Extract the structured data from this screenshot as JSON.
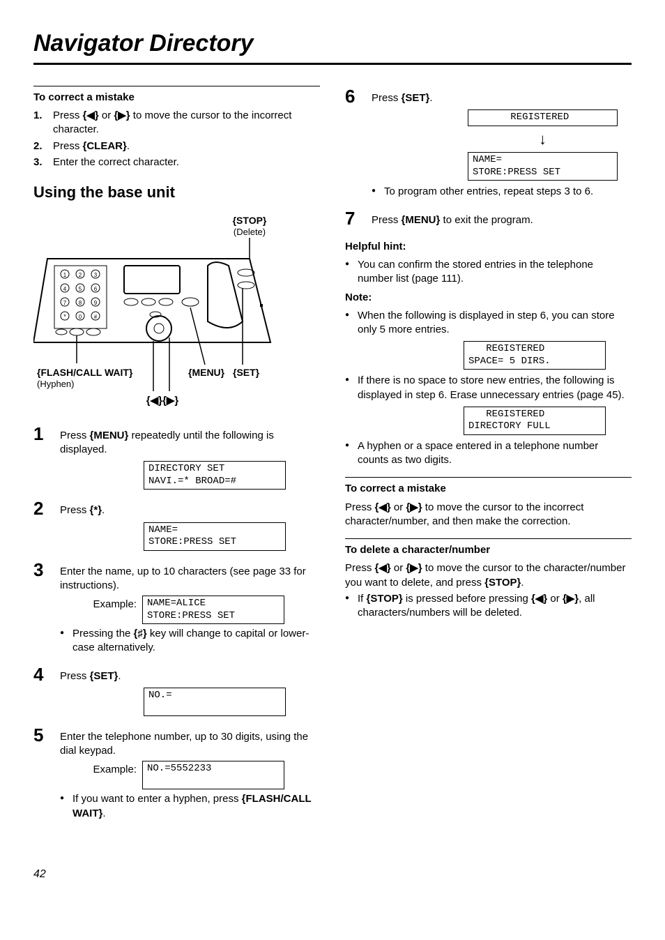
{
  "pageTitle": "Navigator Directory",
  "pageNumber": "42",
  "left": {
    "correct": {
      "head": "To correct a mistake",
      "s1n": "1.",
      "s1": "Press {◀} or {▶} to move the cursor to the incorrect character.",
      "s2n": "2.",
      "s2": "Press {CLEAR}.",
      "s3n": "3.",
      "s3": "Enter the correct character."
    },
    "h2": "Using the base unit",
    "diagram": {
      "stop": "{STOP}",
      "stopSub": "(Delete)",
      "flash": "{FLASH/CALL WAIT}",
      "flashSub": "(Hyphen)",
      "menu": "{MENU}",
      "set": "{SET}",
      "arrows": "{◀}{▶}"
    },
    "step1": {
      "text": "Press {MENU} repeatedly until the following is displayed.",
      "lcd": "DIRECTORY SET\nNAVI.=* BROAD=#"
    },
    "step2": {
      "text": "Press {*}.",
      "lcd": "NAME=\nSTORE:PRESS SET"
    },
    "step3": {
      "text": "Enter the name, up to 10 characters (see page 33 for instructions).",
      "exLabel": "Example:",
      "lcd": "NAME=ALICE\nSTORE:PRESS SET",
      "bullet": "Pressing the {♯} key will change to capital or lower-case alternatively."
    },
    "step4": {
      "text": "Press {SET}.",
      "lcd": "NO.=\n "
    },
    "step5": {
      "text": "Enter the telephone number, up to 30 digits, using the dial keypad.",
      "exLabel": "Example:",
      "lcd": "NO.=5552233\n ",
      "bullet": "If you want to enter a hyphen, press {FLASH/CALL WAIT}."
    }
  },
  "right": {
    "step6": {
      "text": "Press {SET}.",
      "lcd1": "  REGISTERED   ",
      "lcd2": "NAME=\nSTORE:PRESS SET",
      "bullet": "To program other entries, repeat steps 3 to 6."
    },
    "step7": {
      "text": "Press {MENU} to exit the program."
    },
    "hint": {
      "head": "Helpful hint:",
      "b1": "You can confirm the stored entries in the telephone number list (page 111)."
    },
    "note": {
      "head": "Note:",
      "b1": "When the following is displayed in step 6, you can store only 5 more entries.",
      "lcd1": "   REGISTERED\nSPACE= 5 DIRS.",
      "b2": "If there is no space to store new entries, the following is displayed in step 6. Erase unnecessary entries (page 45).",
      "lcd2": "   REGISTERED\nDIRECTORY FULL",
      "b3": "A hyphen or a space entered in a telephone number counts as two digits."
    },
    "correct": {
      "head": "To correct a mistake",
      "text": "Press {◀} or {▶} to move the cursor to the incorrect character/number, and then make the correction."
    },
    "del": {
      "head": "To delete a character/number",
      "text": "Press {◀} or {▶} to move the cursor to the character/number you want to delete, and press {STOP}.",
      "bullet": "If {STOP} is pressed before pressing {◀} or {▶}, all characters/numbers will be deleted."
    }
  }
}
